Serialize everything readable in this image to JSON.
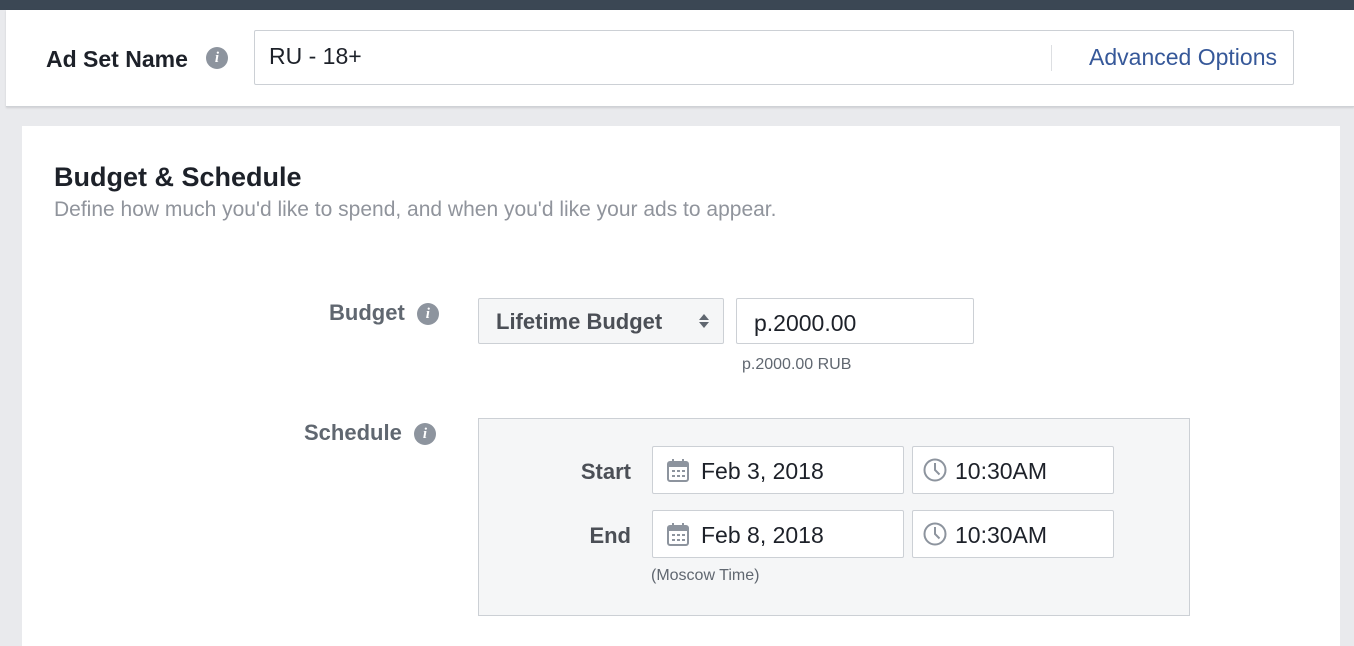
{
  "adset": {
    "name_label": "Ad Set Name",
    "name_value": "RU - 18+",
    "advanced_options": "Advanced Options"
  },
  "section": {
    "title": "Budget & Schedule",
    "subtitle": "Define how much you'd like to spend, and when you'd like your ads to appear."
  },
  "budget": {
    "label": "Budget",
    "type_selected": "Lifetime Budget",
    "amount": "p.2000.00",
    "helper": "p.2000.00 RUB"
  },
  "schedule": {
    "label": "Schedule",
    "start_label": "Start",
    "start_date": "Feb 3, 2018",
    "start_time": "10:30AM",
    "end_label": "End",
    "end_date": "Feb 8, 2018",
    "end_time": "10:30AM",
    "timezone": "(Moscow Time)"
  },
  "icons": {
    "info": "i"
  },
  "colors": {
    "link": "#365899",
    "topbar": "#3b4754",
    "info_icon": "#8d949e"
  }
}
